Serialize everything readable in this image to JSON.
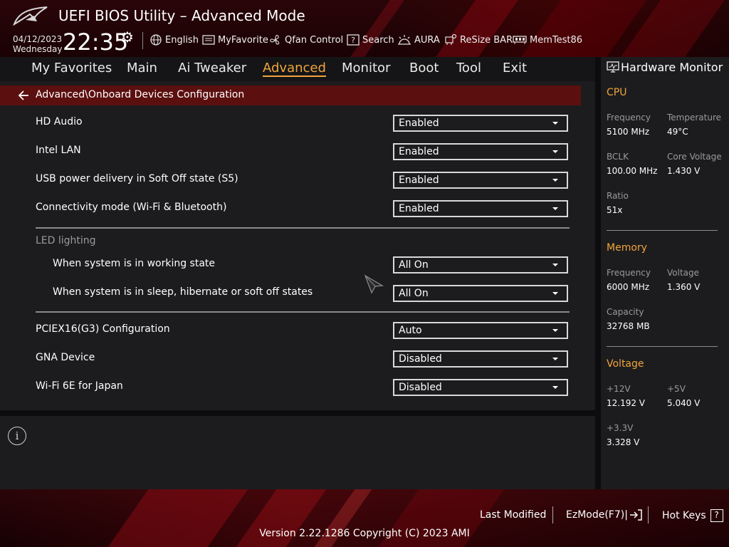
{
  "header": {
    "title": "UEFI BIOS Utility – Advanced Mode",
    "date": "04/12/2023",
    "weekday": "Wednesday",
    "time": "22:35",
    "tools": [
      {
        "label": "English",
        "icon": "globe-icon"
      },
      {
        "label": "MyFavorite",
        "icon": "favorite-icon"
      },
      {
        "label": "Qfan Control",
        "icon": "fan-icon"
      },
      {
        "label": "Search",
        "icon": "search-help-icon"
      },
      {
        "label": "AURA",
        "icon": "aura-icon"
      },
      {
        "label": "ReSize BAR",
        "icon": "resize-bar-icon"
      },
      {
        "label": "MemTest86",
        "icon": "memtest-icon"
      }
    ]
  },
  "tabs": [
    {
      "label": "My Favorites"
    },
    {
      "label": "Main"
    },
    {
      "label": "Ai Tweaker"
    },
    {
      "label": "Advanced",
      "active": true
    },
    {
      "label": "Monitor"
    },
    {
      "label": "Boot"
    },
    {
      "label": "Tool"
    },
    {
      "label": "Exit"
    }
  ],
  "main": {
    "breadcrumb": "Advanced\\Onboard Devices Configuration",
    "settings": [
      {
        "label": "HD Audio",
        "value": "Enabled"
      },
      {
        "label": "Intel LAN",
        "value": "Enabled"
      },
      {
        "label": "USB power delivery in Soft Off state (S5)",
        "value": "Enabled"
      },
      {
        "label": "Connectivity mode (Wi-Fi & Bluetooth)",
        "value": "Enabled"
      }
    ],
    "led_section": "LED lighting",
    "led_settings": [
      {
        "label": "When system is in working state",
        "value": "All On"
      },
      {
        "label": "When system is in sleep, hibernate or soft off states",
        "value": "All On"
      }
    ],
    "more_settings": [
      {
        "label": "PCIEX16(G3) Configuration",
        "value": "Auto"
      },
      {
        "label": "GNA Device",
        "value": "Disabled"
      },
      {
        "label": "Wi-Fi 6E for Japan",
        "value": "Disabled"
      }
    ]
  },
  "hardware_monitor": {
    "title": "Hardware Monitor",
    "cpu": {
      "heading": "CPU",
      "frequency_label": "Frequency",
      "frequency": "5100 MHz",
      "temperature_label": "Temperature",
      "temperature": "49°C",
      "bclk_label": "BCLK",
      "bclk": "100.00 MHz",
      "core_voltage_label": "Core Voltage",
      "core_voltage": "1.430 V",
      "ratio_label": "Ratio",
      "ratio": "51x"
    },
    "memory": {
      "heading": "Memory",
      "frequency_label": "Frequency",
      "frequency": "6000 MHz",
      "voltage_label": "Voltage",
      "voltage": "1.360 V",
      "capacity_label": "Capacity",
      "capacity": "32768 MB"
    },
    "voltage": {
      "heading": "Voltage",
      "v12_label": "+12V",
      "v12": "12.192 V",
      "v5_label": "+5V",
      "v5": "5.040 V",
      "v33_label": "+3.3V",
      "v33": "3.328 V"
    }
  },
  "footer": {
    "last_modified": "Last Modified",
    "ezmode": "EzMode(F7)|",
    "hot_keys": "Hot Keys",
    "hot_keys_key": "?",
    "version": "Version 2.22.1286 Copyright (C) 2023 AMI"
  },
  "colors": {
    "accent": "#f0a43c",
    "breadcrumb_bg": "#5c0f0f",
    "panel_bg": "#1c1c1e"
  }
}
